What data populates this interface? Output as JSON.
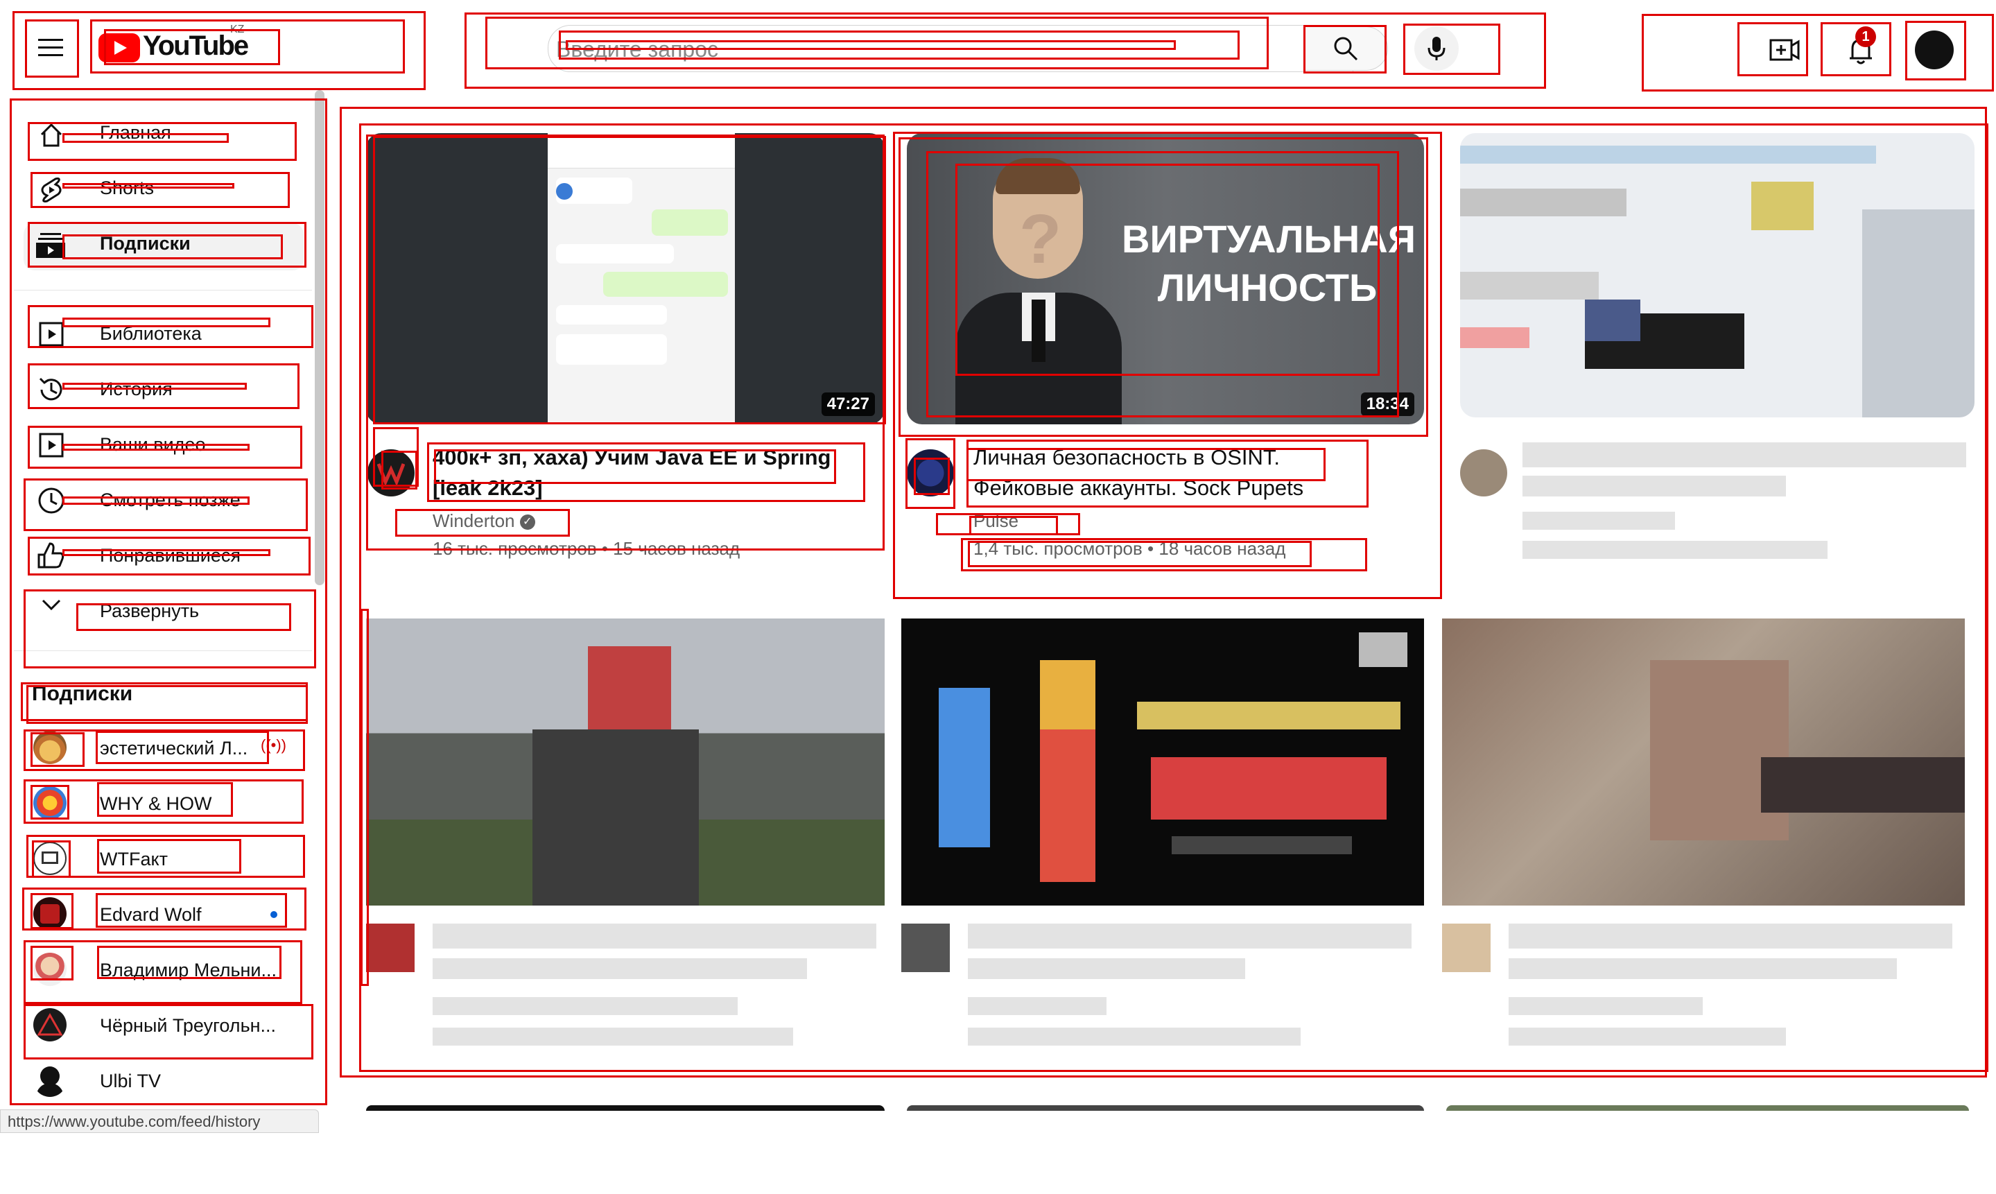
{
  "header": {
    "logo_text": "YouTube",
    "region": "KZ",
    "search_placeholder": "Введите запрос",
    "notification_count": "1"
  },
  "sidebar": {
    "items": [
      {
        "label": "Главная",
        "icon": "home-icon"
      },
      {
        "label": "Shorts",
        "icon": "shorts-icon"
      },
      {
        "label": "Подписки",
        "icon": "subscriptions-icon"
      },
      {
        "label": "Библиотека",
        "icon": "library-icon"
      },
      {
        "label": "История",
        "icon": "history-icon"
      },
      {
        "label": "Ваши видео",
        "icon": "your-videos-icon"
      },
      {
        "label": "Смотреть позже",
        "icon": "watch-later-icon"
      },
      {
        "label": "Понравившиеся",
        "icon": "liked-icon"
      },
      {
        "label": "Развернуть",
        "icon": "chevron-down-icon"
      }
    ],
    "subscriptions_heading": "Подписки",
    "subscriptions": [
      {
        "name": "эстетический Л...",
        "live": true
      },
      {
        "name": "WHY & HOW",
        "live": false
      },
      {
        "name": "WTFакт",
        "live": false
      },
      {
        "name": "Edvard Wolf",
        "new": true
      },
      {
        "name": "Владимир Мельни...",
        "live": false
      },
      {
        "name": "Чёрный Треугольн...",
        "live": false
      },
      {
        "name": "Ulbi TV",
        "live": false
      }
    ]
  },
  "status_url": "https://www.youtube.com/feed/history",
  "videos": [
    {
      "title_line1": "400к+ зп, хаха) Учим Java EE и Spring",
      "title_line2": "[leak 2k23]",
      "channel": "Winderton",
      "meta": "16 тыс. просмотров • 15 часов назад",
      "duration": "47:27"
    },
    {
      "title_line1": "Личная безопасность в OSINT.",
      "title_line2": "Фейковые аккаунты. Sock Pupets",
      "channel": "Pulse",
      "meta": "1,4 тыс. просмотров • 18 часов назад",
      "duration": "18:34",
      "thumb_text_line1": "ВИРТУАЛЬНАЯ",
      "thumb_text_line2": "ЛИЧНОСТЬ"
    }
  ],
  "colors": {
    "brand_red": "#ff0000",
    "annotation_red": "#e00000",
    "text": "#0f0f0f",
    "meta": "#606060"
  }
}
